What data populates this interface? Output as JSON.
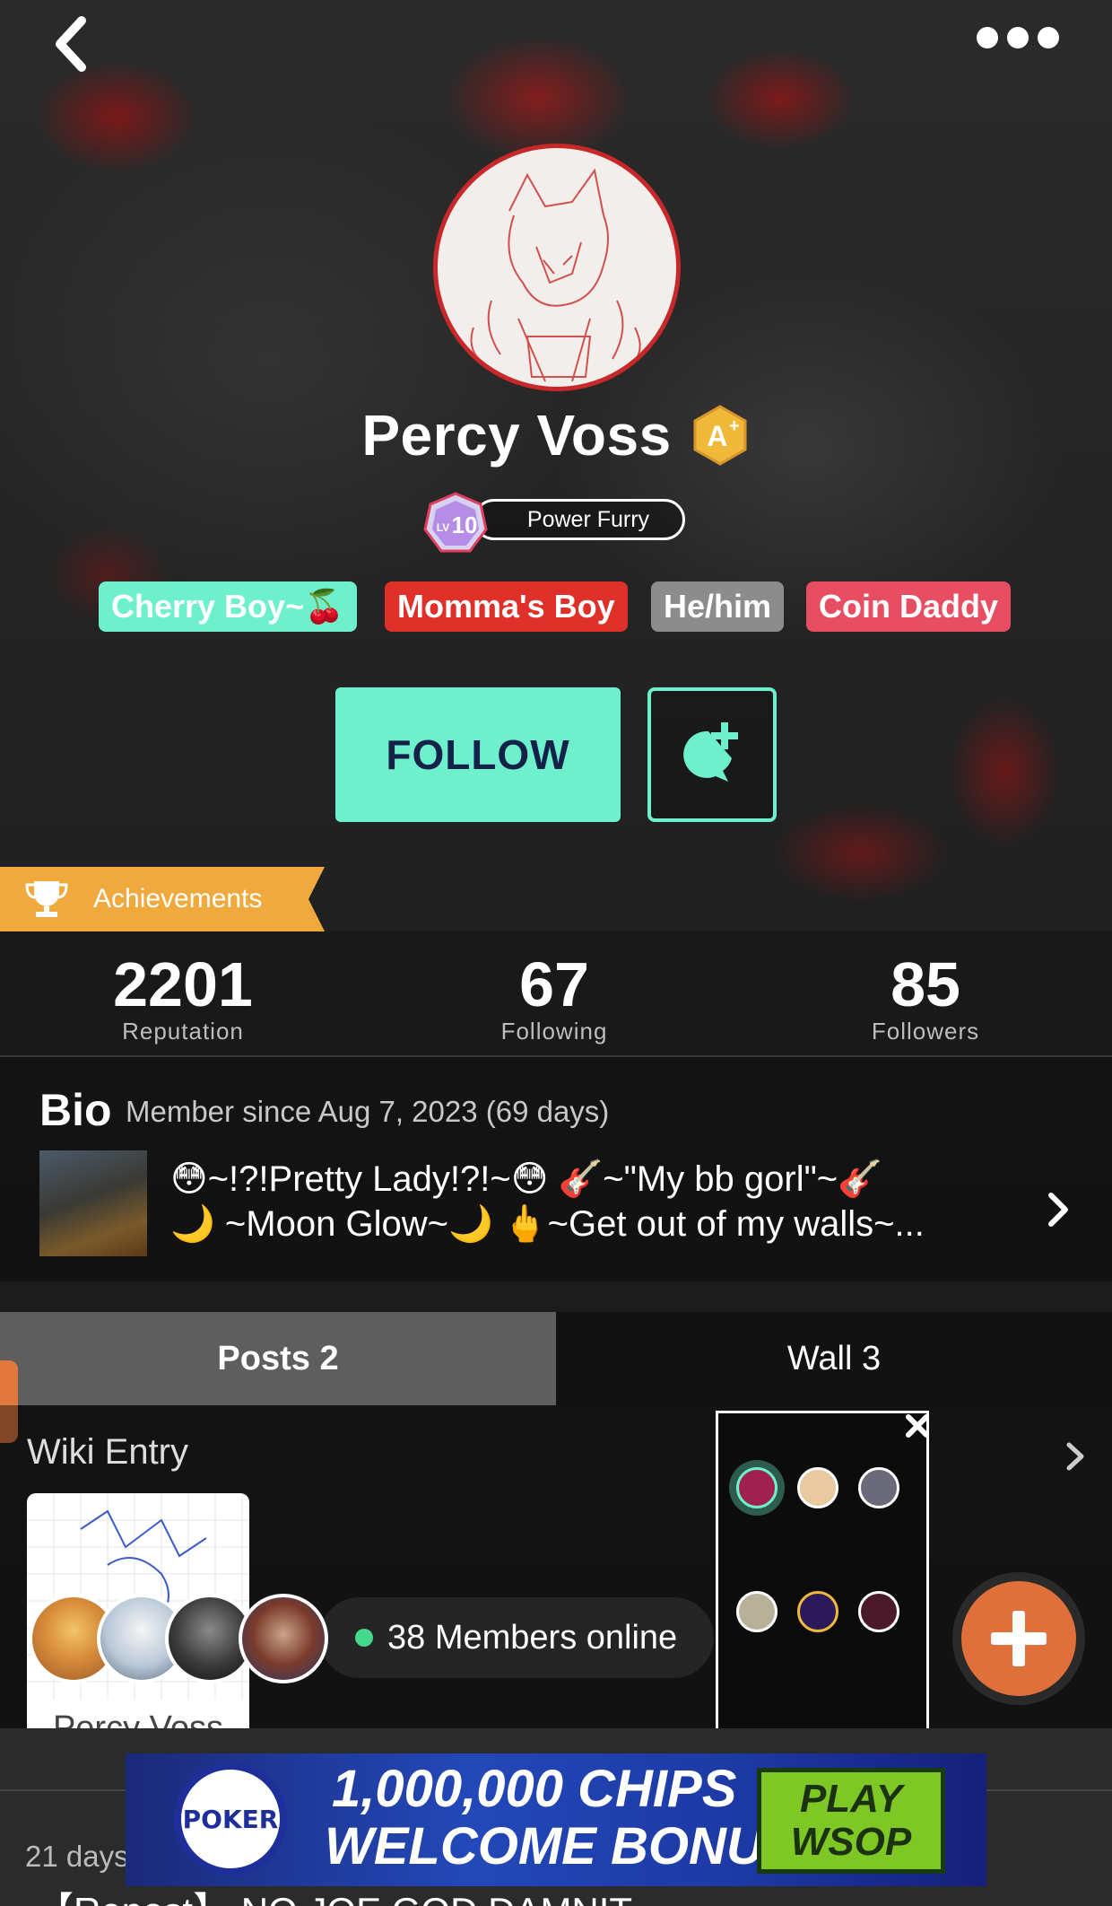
{
  "profile": {
    "name": "Percy Voss",
    "level": "10",
    "title": "Power Furry"
  },
  "tags": [
    {
      "label": "Cherry Boy~🍒",
      "color": "#6ef0cc",
      "text": "#ffffff"
    },
    {
      "label": "Momma's Boy",
      "color": "#e0302a",
      "text": "#ffffff"
    },
    {
      "label": "He/him",
      "color": "#8c8c8c",
      "text": "#ffffff"
    },
    {
      "label": "Coin Daddy",
      "color": "#e84e62",
      "text": "#ffffff"
    }
  ],
  "actions": {
    "follow_label": "FOLLOW"
  },
  "achievements": {
    "label": "Achievements"
  },
  "stats": [
    {
      "value": "2201",
      "label": "Reputation"
    },
    {
      "value": "67",
      "label": "Following"
    },
    {
      "value": "85",
      "label": "Followers"
    }
  ],
  "bio": {
    "title": "Bio",
    "member_since": "Member since Aug 7, 2023 (69 days)",
    "line1": "😳~!?!Pretty Lady!?!~😳 🎸~\"My bb gorl\"~🎸",
    "line2": "🌙 ~Moon Glow~🌙 🖕~Get out of my walls~..."
  },
  "tabs": [
    {
      "label": "Posts 2"
    },
    {
      "label": "Wall 3"
    }
  ],
  "wiki": {
    "title": "Wiki Entry",
    "card_label": "Percy Voss"
  },
  "members": {
    "online_text": "38 Members online"
  },
  "ad": {
    "logo_text": "POKER",
    "line1": "1,000,000 CHIPS",
    "line2": "WELCOME BONUS!",
    "cta_line1": "PLAY",
    "cta_line2": "WSOP"
  },
  "feed": {
    "days_text": "21 days",
    "post_title": "【Repost】 NO JOE GOD DAMNIT"
  },
  "colors": {
    "accent": "#6ef0cc",
    "achievement": "#f0a93c",
    "fab": "#e0703a"
  }
}
